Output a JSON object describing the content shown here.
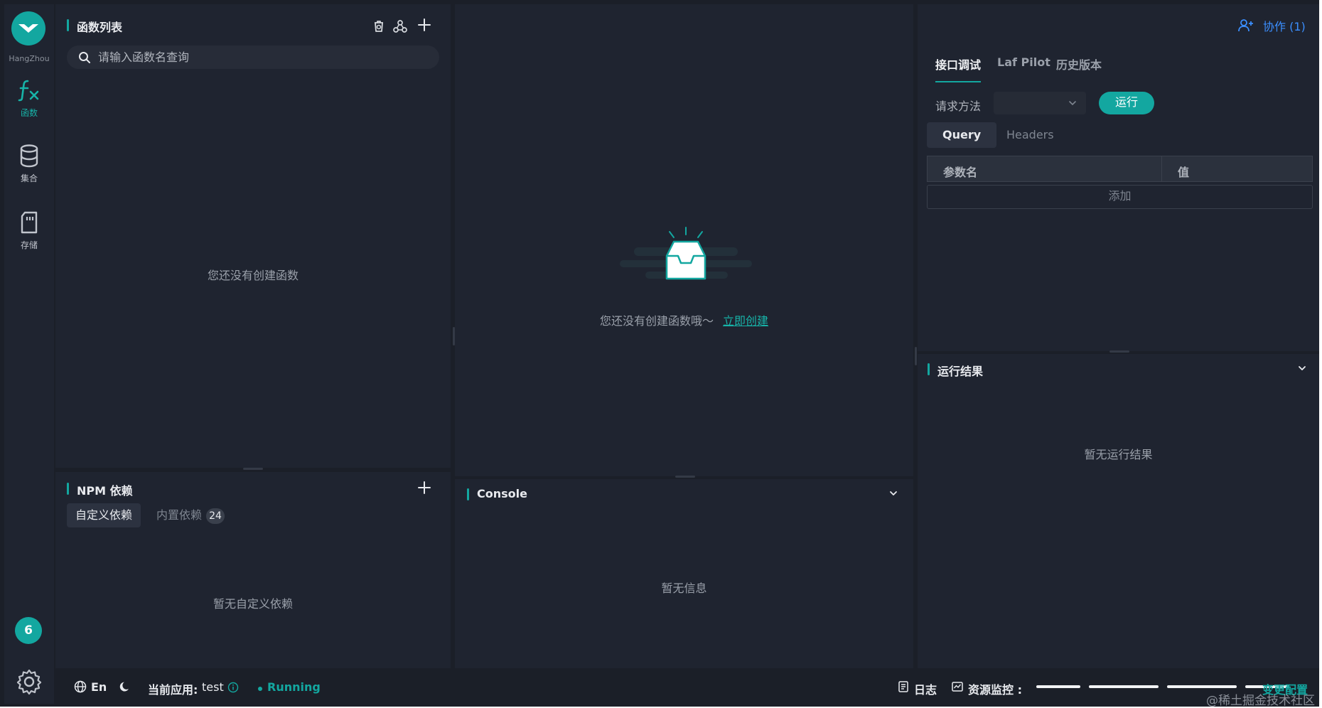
{
  "rail": {
    "region": "HangZhou",
    "nav": [
      {
        "label": "函数",
        "icon": "function-icon"
      },
      {
        "label": "集合",
        "icon": "database-icon"
      },
      {
        "label": "存储",
        "icon": "storage-card-icon"
      }
    ],
    "avatar": "6"
  },
  "functions": {
    "title": "函数列表",
    "search_placeholder": "请输入函数名查询",
    "empty": "您还没有创建函数"
  },
  "npm": {
    "title": "NPM 依赖",
    "tab_custom": "自定义依赖",
    "tab_builtin": "内置依赖",
    "builtin_count": "24",
    "empty": "暂无自定义依赖"
  },
  "editor": {
    "empty": "您还没有创建函数哦～",
    "create_link": "立即创建"
  },
  "console": {
    "title": "Console",
    "empty": "暂无信息"
  },
  "debug": {
    "tabs": [
      "接口调试",
      "Laf Pilot",
      "历史版本"
    ],
    "method_label": "请求方法",
    "run": "运行",
    "query_tab": "Query",
    "headers_tab": "Headers",
    "col_name": "参数名",
    "col_value": "值",
    "add": "添加"
  },
  "result": {
    "title": "运行结果",
    "empty": "暂无运行结果"
  },
  "header": {
    "collab": "协作 (1)"
  },
  "status": {
    "lang": "En",
    "app_label": "当前应用:",
    "app_name": "test",
    "state": "Running",
    "logs": "日志",
    "monitor": "资源监控 :",
    "config": "变更配置"
  },
  "watermark": "@稀土掘金技术社区",
  "colors": {
    "accent": "#13a7a0",
    "link": "#3b8fff",
    "panel": "#1f2430",
    "background": "#1b1f28"
  }
}
